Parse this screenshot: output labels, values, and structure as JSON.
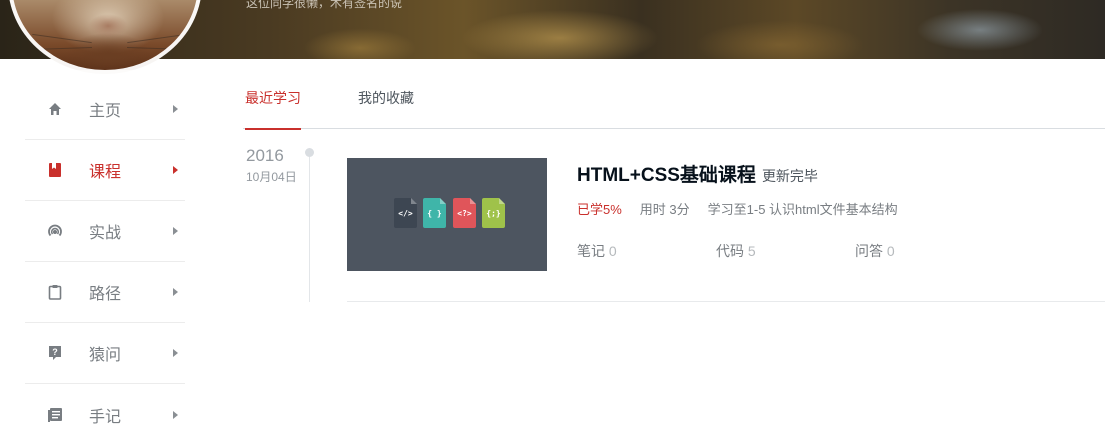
{
  "banner": {
    "signature": "这位同学很懒，木有签名的说"
  },
  "sidebar": {
    "items": [
      {
        "label": "主页",
        "icon": "home-icon"
      },
      {
        "label": "课程",
        "icon": "bookmark-icon",
        "active": true
      },
      {
        "label": "实战",
        "icon": "signal-icon"
      },
      {
        "label": "路径",
        "icon": "clipboard-icon"
      },
      {
        "label": "猿问",
        "icon": "question-icon"
      },
      {
        "label": "手记",
        "icon": "notes-icon"
      }
    ]
  },
  "tabs": [
    {
      "label": "最近学习",
      "active": true
    },
    {
      "label": "我的收藏",
      "active": false
    }
  ],
  "timeline": {
    "year": "2016",
    "date": "10月04日"
  },
  "course": {
    "title": "HTML+CSS基础课程",
    "status": "更新完毕",
    "progress": "已学5%",
    "time_used": "用时 3分",
    "learned_to": "学习至1-5 认识html文件基本结构",
    "notes_label": "笔记",
    "notes_count": "0",
    "code_label": "代码",
    "code_count": "5",
    "qa_label": "问答",
    "qa_count": "0",
    "thumb_files": [
      {
        "glyph": "</>",
        "color": "#3d4652"
      },
      {
        "glyph": "{ }",
        "color": "#3fb5a9"
      },
      {
        "glyph": "<?>",
        "color": "#e0555a"
      },
      {
        "glyph": "{;}",
        "color": "#9fc24a"
      }
    ]
  },
  "colors": {
    "accent": "#c9302c",
    "muted": "#787d82"
  }
}
